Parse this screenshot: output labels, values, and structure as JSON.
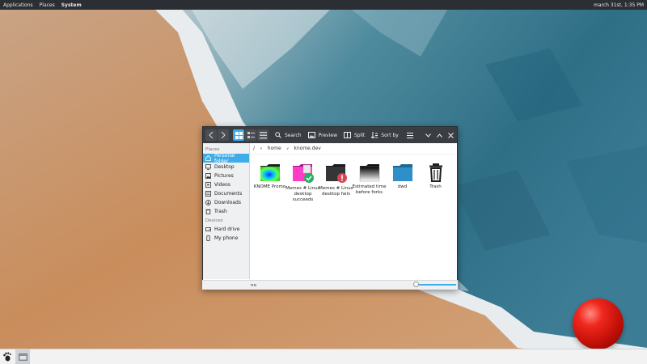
{
  "top_panel": {
    "menus": [
      "Applications",
      "Places",
      "System"
    ],
    "clock": "march 31st, 1:35 PM"
  },
  "window": {
    "toolbar": {
      "search": "Search",
      "preview": "Preview",
      "split": "Split",
      "sort": "Sort by"
    },
    "sidebar": {
      "places_heading": "Places",
      "places": [
        {
          "label": "Personal folder",
          "icon": "home-icon",
          "active": true
        },
        {
          "label": "Desktop",
          "icon": "desktop-icon"
        },
        {
          "label": "Pictures",
          "icon": "pictures-icon"
        },
        {
          "label": "Videos",
          "icon": "videos-icon"
        },
        {
          "label": "Documents",
          "icon": "documents-icon"
        },
        {
          "label": "Downloads",
          "icon": "downloads-icon"
        },
        {
          "label": "Trash",
          "icon": "trash-icon"
        }
      ],
      "devices_heading": "Devices",
      "devices": [
        {
          "label": "Hard drive",
          "icon": "hard-drive-icon"
        },
        {
          "label": "My phone",
          "icon": "phone-icon"
        }
      ]
    },
    "breadcrumbs": [
      "/",
      "home",
      "knome.dev"
    ],
    "files": [
      {
        "label": "KNOME Promo",
        "icon": "image-folder-icon"
      },
      {
        "label": "Memes # Linux desktop succeeds",
        "icon": "pink-folder-check-icon"
      },
      {
        "label": "Memes # Linux desktop fails",
        "icon": "dark-folder-error-icon"
      },
      {
        "label": "Estimated time before forks",
        "icon": "gradient-folder-icon"
      },
      {
        "label": "dwd",
        "icon": "blue-folder-icon"
      },
      {
        "label": "Trash",
        "icon": "trash-icon"
      }
    ],
    "status_text": "no",
    "zoom_level": 0.05
  },
  "colors": {
    "accent": "#3daee9",
    "titlebar": "#3a3d42",
    "panel": "#2b2e33"
  }
}
